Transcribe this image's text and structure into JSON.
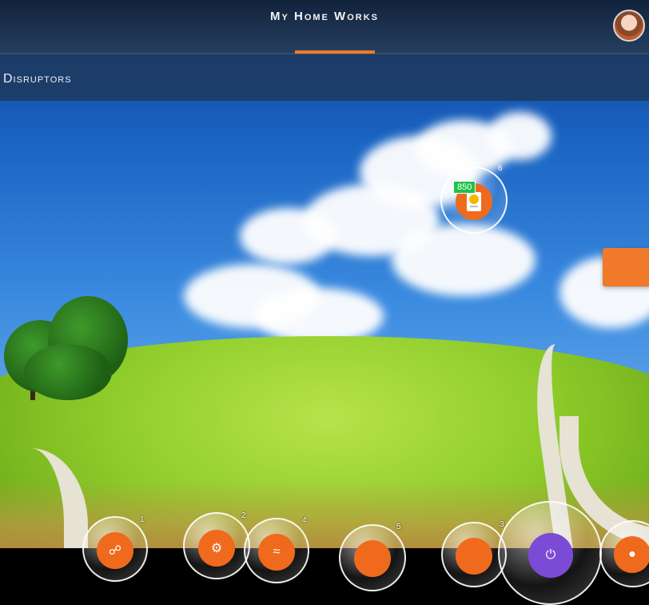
{
  "header": {
    "app_title": "My Home Works"
  },
  "subheader": {
    "section_title": "Disruptors"
  },
  "floating_disruptor": {
    "score": "850",
    "count": "6"
  },
  "tray": [
    {
      "count": "1",
      "icon": "network-icon",
      "color": "#f06a1e"
    },
    {
      "count": "2",
      "icon": "gear-icon",
      "color": "#f06a1e"
    },
    {
      "count": "4",
      "icon": "wind-icon",
      "color": "#f06a1e"
    },
    {
      "count": "5",
      "icon": "generic-icon",
      "color": "#f06a1e"
    },
    {
      "count": "3",
      "icon": "generic-icon",
      "color": "#f06a1e"
    },
    {
      "count": "",
      "icon": "power-icon",
      "color": "#7b4bd6"
    },
    {
      "count": "",
      "icon": "mask-icon",
      "color": "#f06a1e"
    }
  ],
  "colors": {
    "accent": "#f07a2a",
    "score_badge": "#1ec24a",
    "header_bg": "#1e3a60"
  }
}
